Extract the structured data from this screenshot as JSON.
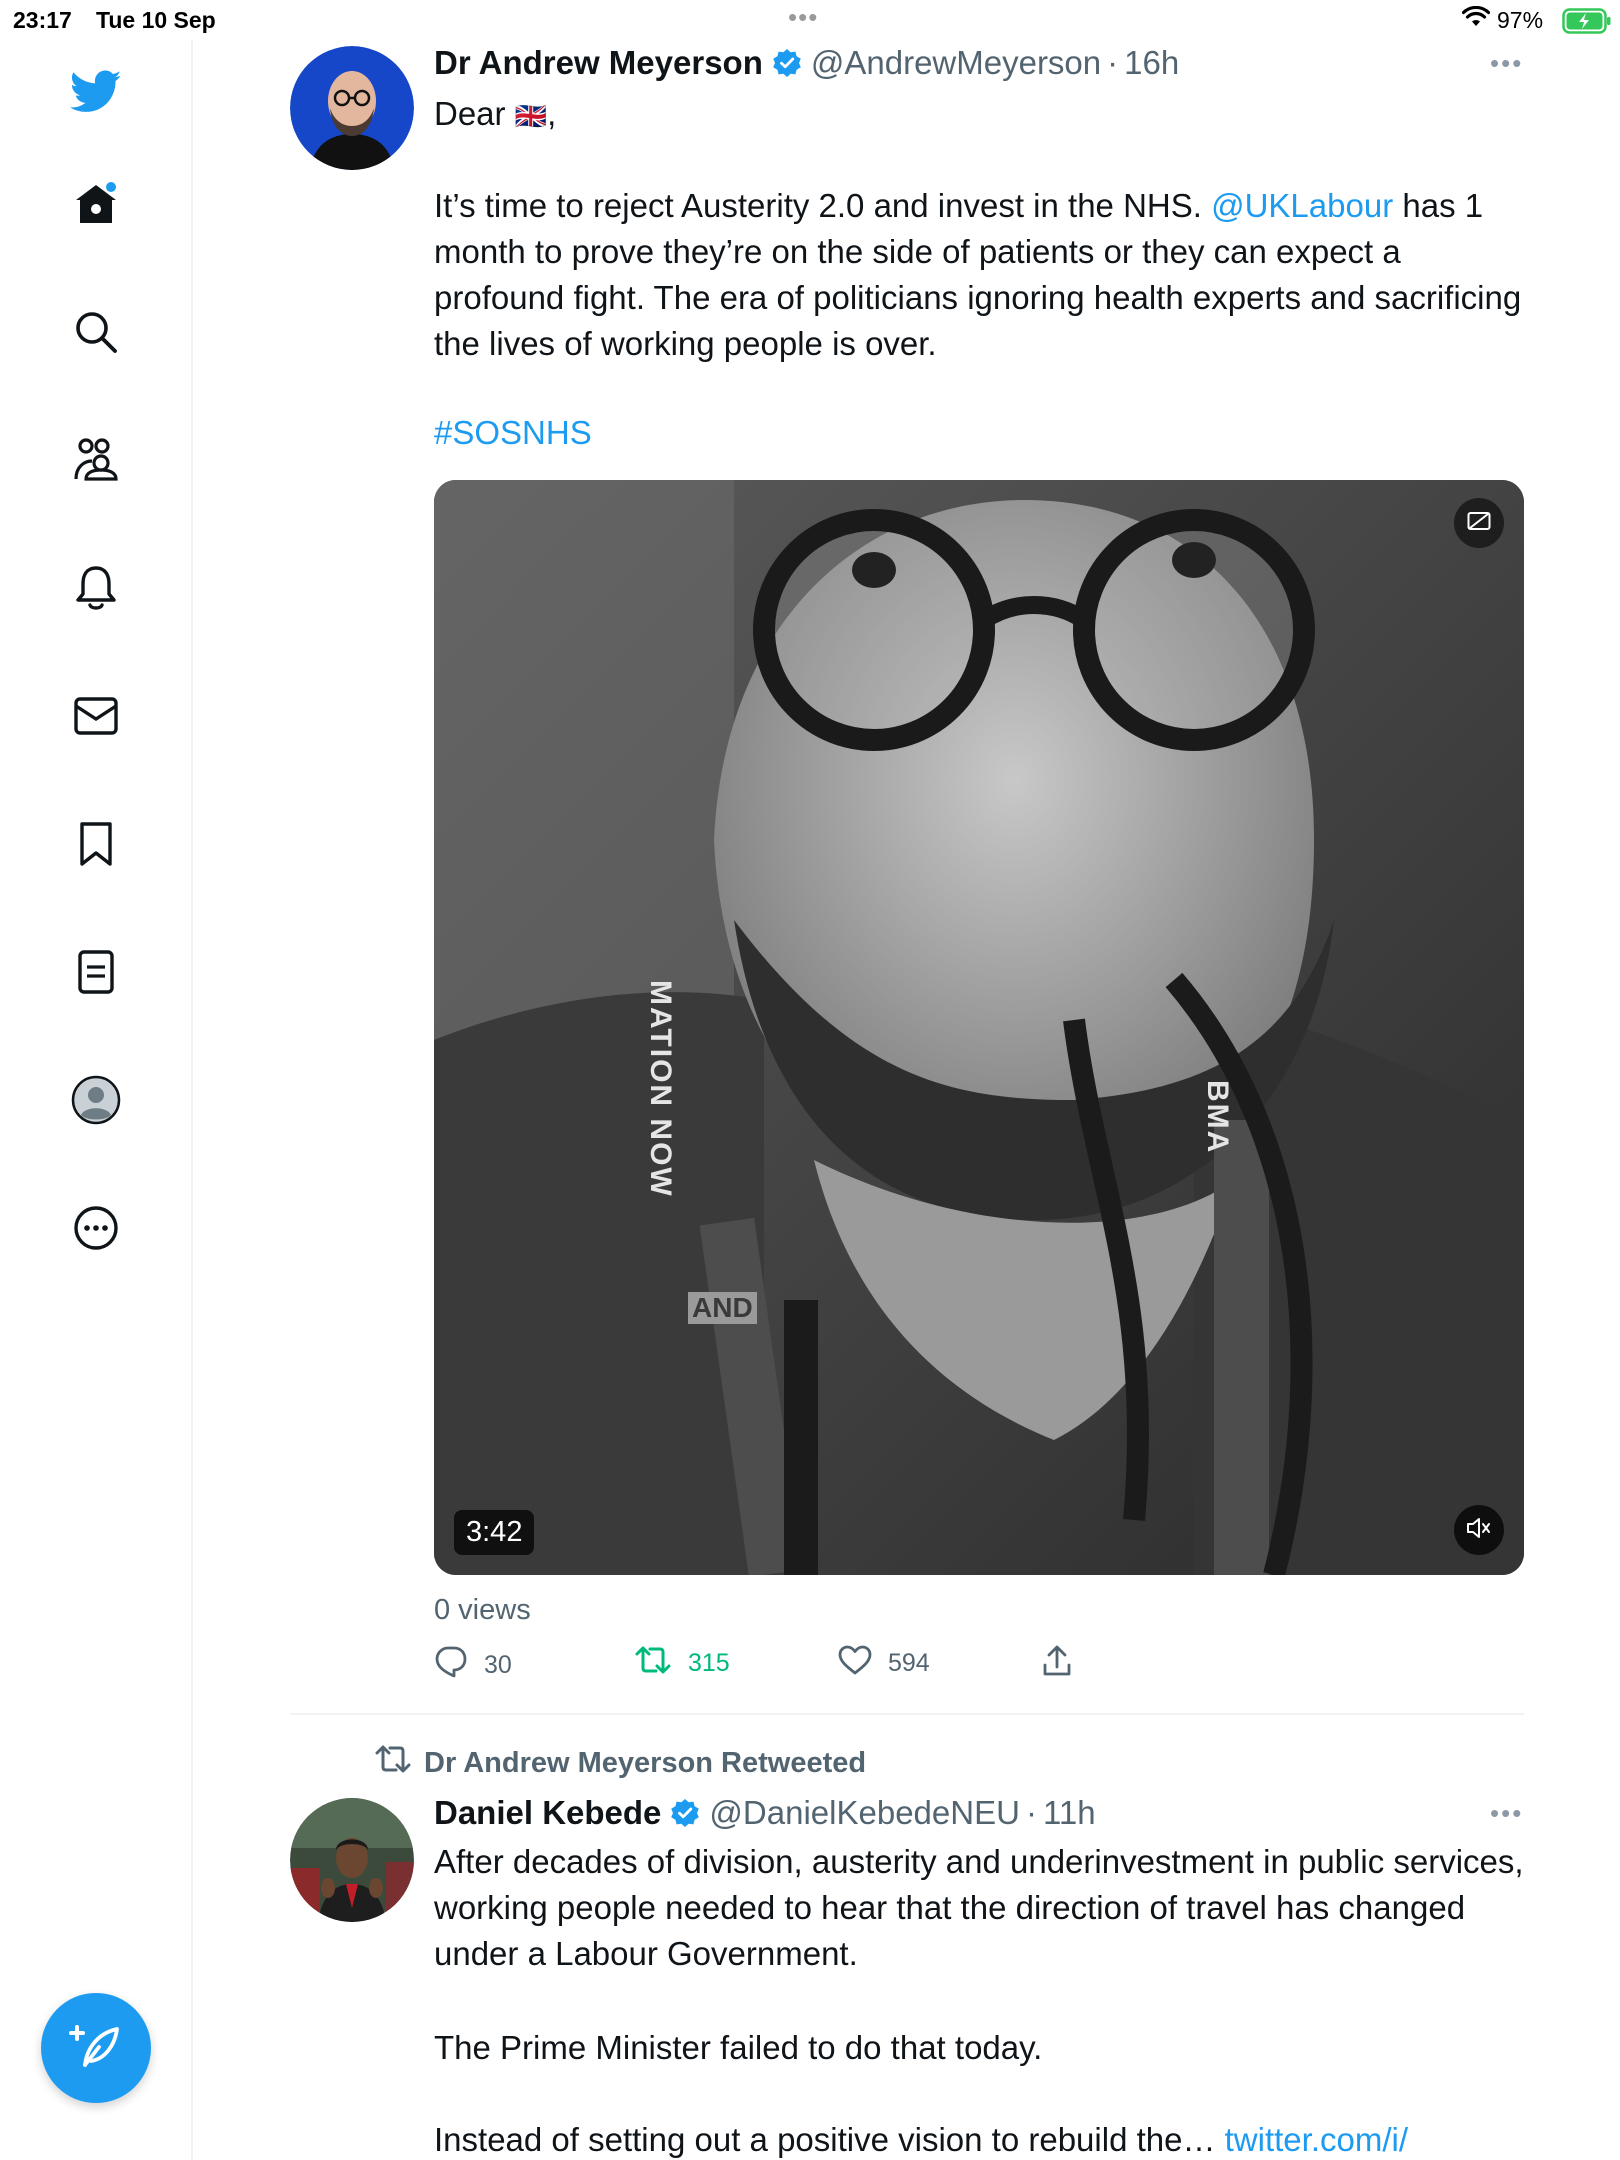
{
  "status_bar": {
    "time": "23:17",
    "date": "Tue 10 Sep",
    "battery": "97%"
  },
  "colors": {
    "accent": "#1d9bf0",
    "retweet": "#00ba7c",
    "secondary_text": "#536471",
    "battery_green": "#34c759"
  },
  "sidebar": {
    "items": [
      {
        "name": "twitter-logo",
        "icon": "bird-icon"
      },
      {
        "name": "home",
        "icon": "home-icon"
      },
      {
        "name": "explore",
        "icon": "search-icon"
      },
      {
        "name": "communities",
        "icon": "people-icon"
      },
      {
        "name": "notifications",
        "icon": "bell-icon"
      },
      {
        "name": "messages",
        "icon": "envelope-icon"
      },
      {
        "name": "bookmarks",
        "icon": "bookmark-icon"
      },
      {
        "name": "lists",
        "icon": "list-icon"
      },
      {
        "name": "profile",
        "icon": "avatar-icon"
      },
      {
        "name": "more",
        "icon": "more-circle-icon"
      }
    ],
    "compose_icon": "feather-plus-icon"
  },
  "tweet1": {
    "display_name": "Dr Andrew Meyerson",
    "handle": "@AndrewMeyerson",
    "time": "16h",
    "greeting": "Dear",
    "flag": "🇬🇧",
    "greeting_suffix": ",",
    "body_part1": "It’s time to reject Austerity 2.0 and invest in the NHS. ",
    "mention": "@UKLabour",
    "body_part2": " has 1 month to prove they’re on the side of patients or they can expect a profound fight. The era of politicians ignoring health experts and sacrificing the lives of working people is over.",
    "hashtag": "#SOSNHS",
    "video": {
      "duration": "3:42",
      "lanyard_text_left": "MATION NOW",
      "lanyard_text_right": "BMA",
      "caption_word": "AND"
    },
    "views": "0 views",
    "replies": "30",
    "retweets": "315",
    "likes": "594"
  },
  "tweet2": {
    "retweeted_by": "Dr Andrew Meyerson Retweeted",
    "display_name": "Daniel Kebede",
    "handle": "@DanielKebedeNEU",
    "time": "11h",
    "para1": "After decades of division, austerity and underinvestment in public services, working people needed to hear that the direction of travel has changed under a Labour Government.",
    "para2": "The Prime Minister failed to do that today.",
    "para3": "Instead of setting out a positive vision to rebuild the… ",
    "link": "twitter.com/i/"
  }
}
